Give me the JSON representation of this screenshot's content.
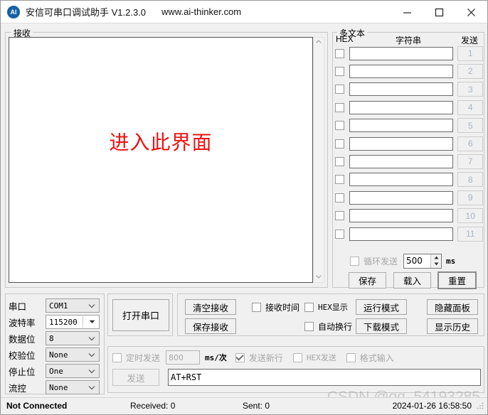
{
  "window": {
    "icon_label": "AI",
    "title": "安信可串口调试助手 V1.2.3.0",
    "url": "www.ai-thinker.com",
    "minimize_icon": "minimize-icon",
    "maximize_icon": "maximize-icon",
    "close_icon": "close-icon"
  },
  "receive": {
    "group_label": "接收",
    "annotation": "进入此界面",
    "scroll_up": "⌃",
    "scroll_down": "⌄"
  },
  "multitext": {
    "group_label": "多文本",
    "header_hex": "HEX",
    "header_string": "字符串",
    "header_send": "发送",
    "rows": [
      {
        "hex_checked": false,
        "value": "",
        "send_label": "1"
      },
      {
        "hex_checked": false,
        "value": "",
        "send_label": "2"
      },
      {
        "hex_checked": false,
        "value": "",
        "send_label": "3"
      },
      {
        "hex_checked": false,
        "value": "",
        "send_label": "4"
      },
      {
        "hex_checked": false,
        "value": "",
        "send_label": "5"
      },
      {
        "hex_checked": false,
        "value": "",
        "send_label": "6"
      },
      {
        "hex_checked": false,
        "value": "",
        "send_label": "7"
      },
      {
        "hex_checked": false,
        "value": "",
        "send_label": "8"
      },
      {
        "hex_checked": false,
        "value": "",
        "send_label": "9"
      },
      {
        "hex_checked": false,
        "value": "",
        "send_label": "10"
      },
      {
        "hex_checked": false,
        "value": "",
        "send_label": "11"
      }
    ],
    "loop_send_label": "循环发送",
    "loop_send_checked": false,
    "loop_interval": "500",
    "loop_unit": "ms",
    "save_label": "保存",
    "load_label": "载入",
    "reset_label": "重置"
  },
  "serial": {
    "port_label": "串口",
    "port_value": "COM1",
    "baud_label": "波特率",
    "baud_value": "115200",
    "databits_label": "数据位",
    "databits_value": "8",
    "parity_label": "校验位",
    "parity_value": "None",
    "stopbits_label": "停止位",
    "stopbits_value": "One",
    "flow_label": "流控",
    "flow_value": "None",
    "open_button": "打开串口"
  },
  "recv_controls": {
    "clear_button": "清空接收",
    "save_button": "保存接收",
    "recv_time_label": "接收时间",
    "recv_time_checked": false,
    "hex_display_label": "HEX显示",
    "hex_display_checked": false,
    "auto_newline_label": "自动换行",
    "auto_newline_checked": false,
    "run_mode_button": "运行模式",
    "download_mode_button": "下载模式",
    "hide_panel_button": "隐藏面板",
    "show_history_button": "显示历史"
  },
  "send_panel": {
    "timed_send_label": "定时发送",
    "timed_send_checked": false,
    "timed_interval": "800",
    "timed_unit": "ms/次",
    "send_newline_label": "发送新行",
    "send_newline_checked": true,
    "hex_send_label": "HEX发送",
    "hex_send_checked": false,
    "format_input_label": "格式输入",
    "format_input_checked": false,
    "send_button": "发送",
    "send_text": "AT+RST"
  },
  "status": {
    "connection": "Not Connected",
    "received": "Received: 0",
    "sent": "Sent: 0",
    "timestamp": "2024-01-26 16:58:50",
    "watermark": "CSDN @qq_54193285"
  },
  "colors": {
    "annotation_red": "#ee1111",
    "window_bg": "#f0f0f0",
    "titlebar_bg": "#ffffff",
    "accent_blue": "#1560a8"
  }
}
